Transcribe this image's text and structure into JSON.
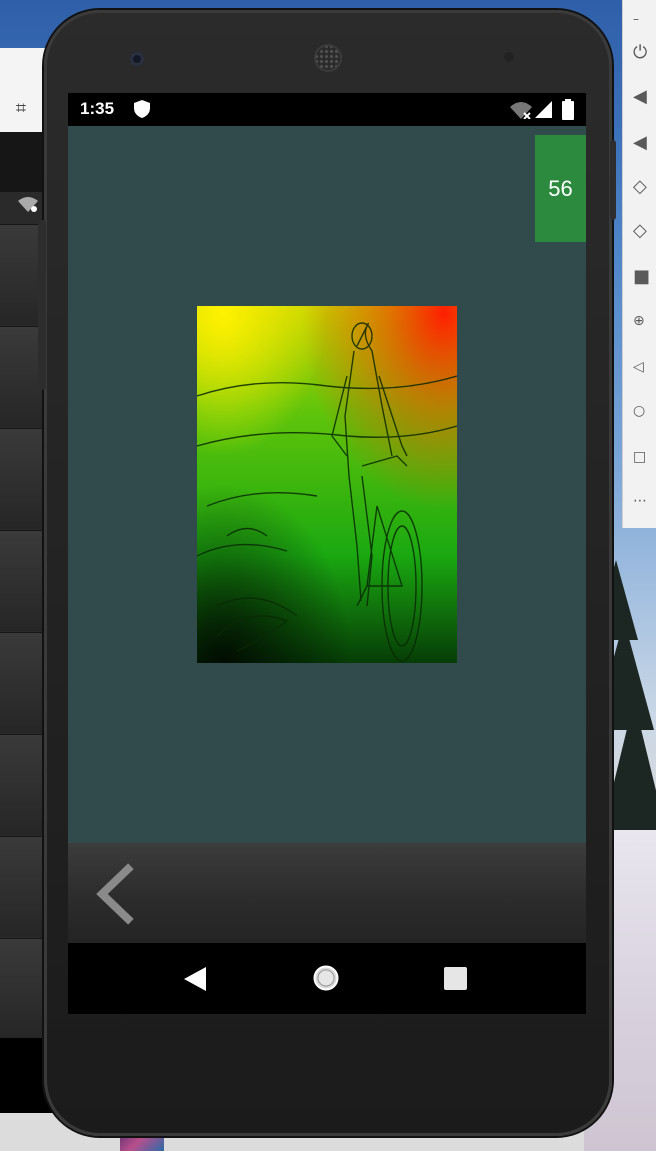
{
  "status_bar": {
    "time": "1:35",
    "icons": [
      "shield-icon",
      "wifi-off-icon",
      "signal-icon",
      "battery-icon"
    ]
  },
  "counter_badge": {
    "value": "56",
    "color": "#2b8a3e"
  },
  "content": {
    "background": "#314a4c"
  },
  "artwork": {
    "description_icon": "cyclist-artwork-image"
  },
  "bottom_bar": {
    "back_icon": "chevron-left-icon"
  },
  "nav_bar": {
    "icons": [
      "nav-back-icon",
      "nav-home-icon",
      "nav-recents-icon"
    ]
  },
  "emulator_toolbar": {
    "icons": [
      "power-icon",
      "volume-up-icon",
      "volume-down-icon",
      "rotate-left-icon",
      "rotate-right-icon",
      "camera-icon",
      "zoom-icon",
      "back-icon",
      "home-icon",
      "overview-icon",
      "more-icon"
    ]
  }
}
